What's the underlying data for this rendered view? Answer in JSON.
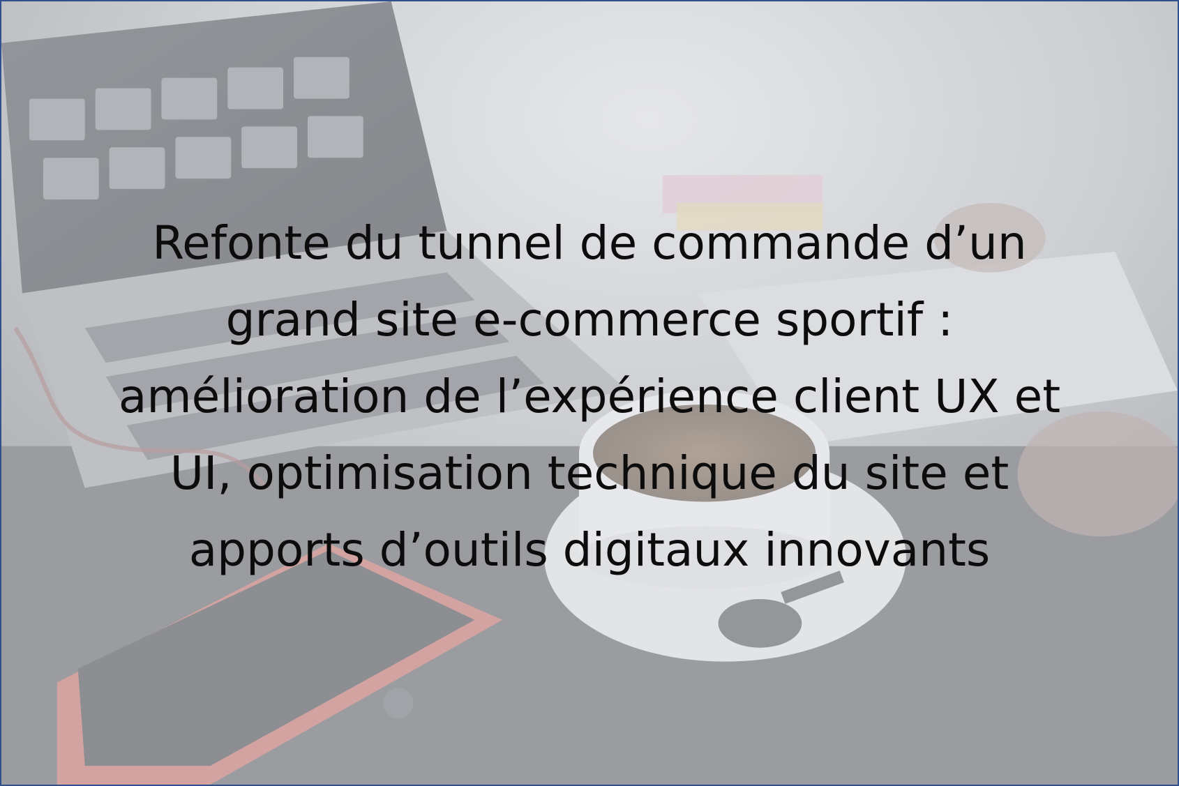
{
  "slide": {
    "lines": [
      "Refonte du tunnel de commande d’un",
      "grand site e-commerce sportif :",
      "amélioration de l’expérience client UX et",
      "UI, optimisation technique du site et",
      "apports d’outils digitaux innovants"
    ]
  }
}
